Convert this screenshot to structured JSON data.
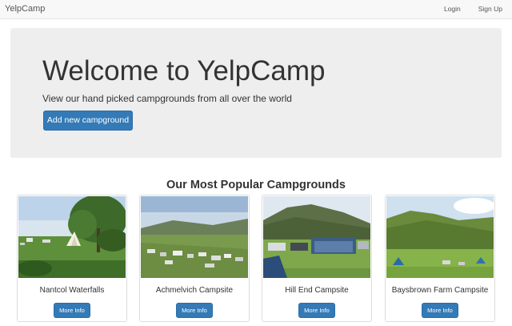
{
  "navbar": {
    "brand": "YelpCamp",
    "links": [
      "Login",
      "Sign Up"
    ]
  },
  "jumbotron": {
    "title": "Welcome to YelpCamp",
    "subtitle": "View our hand picked campgrounds from all over the world",
    "button_label": "Add new campground"
  },
  "section": {
    "heading": "Our Most Popular Campgrounds"
  },
  "campgrounds": [
    {
      "name": "Nantcol Waterfalls",
      "button_label": "More Info"
    },
    {
      "name": "Achmelvich Campsite",
      "button_label": "More Info"
    },
    {
      "name": "Hill End Campsite",
      "button_label": "More Info"
    },
    {
      "name": "Baysbrown Farm Campsite",
      "button_label": "More Info"
    }
  ],
  "colors": {
    "primary": "#337ab7",
    "navbar_bg": "#f8f8f8",
    "jumbotron_bg": "#eeeeee"
  }
}
